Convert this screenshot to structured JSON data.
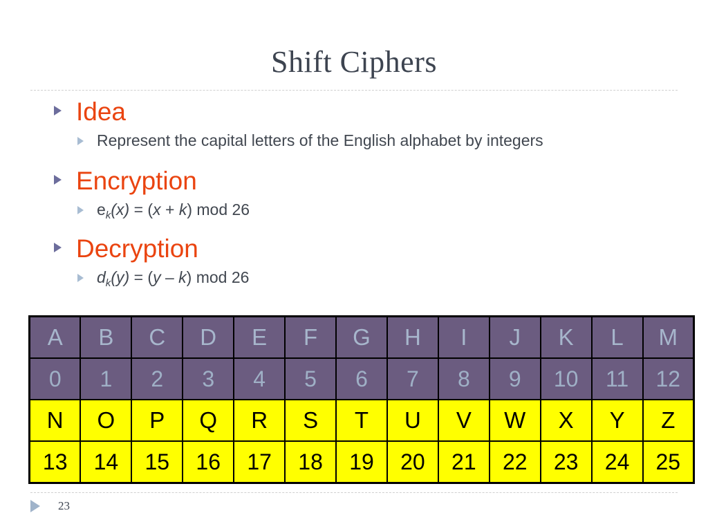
{
  "slide": {
    "title": "Shift Ciphers",
    "page_number": "23",
    "accent_color": "#ea4410",
    "title_color": "#3d4450",
    "bullet_color": "#6c6d9c",
    "subbullet_color": "#a8bcd2",
    "dim_cell_bg": "#6b5c80",
    "dim_cell_fg": "#a7b6cc",
    "highlight_cell_bg": "#ffff00",
    "highlight_cell_fg": "#000000"
  },
  "bullets": [
    {
      "label": "Idea",
      "sub_plain": "Represent the capital letters of the English alphabet by integers",
      "sub_parts": null
    },
    {
      "label": "Encryption",
      "sub_plain": "ek(x) = (x + k) mod 26",
      "sub_parts": {
        "fn": "e",
        "sub": "k",
        "arg": "(x)",
        "eq": " = (",
        "var1": "x",
        "op": " + ",
        "var2": "k",
        "tail": ") mod 26"
      }
    },
    {
      "label": "Decryption",
      "sub_plain": "dk(y) = (y – k) mod 26",
      "sub_parts": {
        "fn": "d",
        "sub": "k",
        "arg": "(y)",
        "eq": " = (",
        "var1": "y",
        "op": " – ",
        "var2": "k",
        "tail": ") mod 26"
      }
    }
  ],
  "chart_data": {
    "type": "table",
    "title": "Shift Cipher alphabet/integer correspondence",
    "columns": 13,
    "rows": [
      {
        "name": "letters-a-m",
        "style": "dim",
        "cells": [
          "A",
          "B",
          "C",
          "D",
          "E",
          "F",
          "G",
          "H",
          "I",
          "J",
          "K",
          "L",
          "M"
        ]
      },
      {
        "name": "numbers-0-12",
        "style": "dim",
        "cells": [
          "0",
          "1",
          "2",
          "3",
          "4",
          "5",
          "6",
          "7",
          "8",
          "9",
          "10",
          "11",
          "12"
        ]
      },
      {
        "name": "letters-n-z",
        "style": "highlight",
        "cells": [
          "N",
          "O",
          "P",
          "Q",
          "R",
          "S",
          "T",
          "U",
          "V",
          "W",
          "X",
          "Y",
          "Z"
        ]
      },
      {
        "name": "numbers-13-25",
        "style": "highlight",
        "cells": [
          "13",
          "14",
          "15",
          "16",
          "17",
          "18",
          "19",
          "20",
          "21",
          "22",
          "23",
          "24",
          "25"
        ]
      }
    ]
  }
}
